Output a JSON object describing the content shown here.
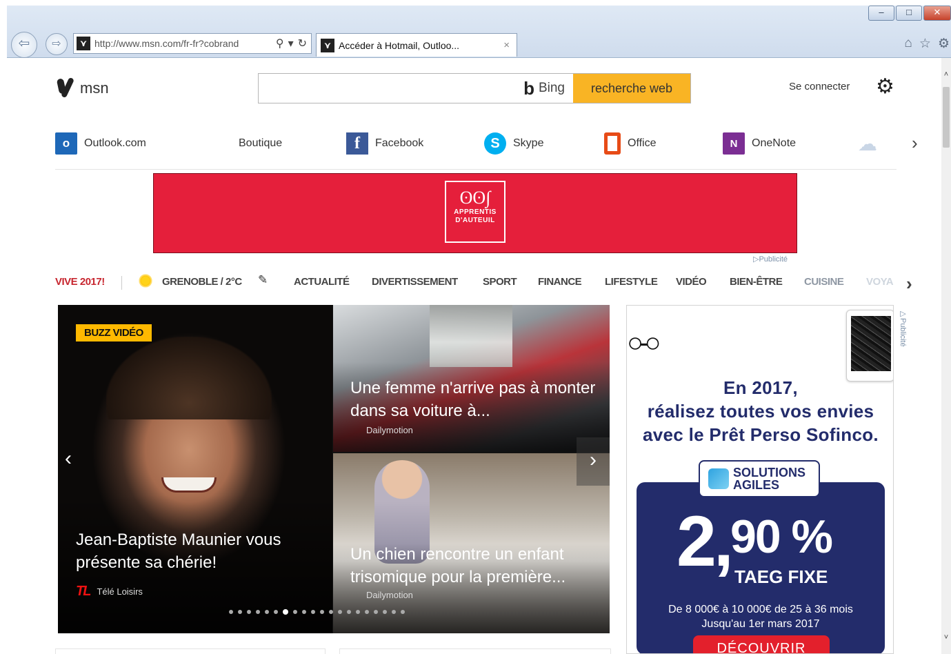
{
  "browser": {
    "url": "http://www.msn.com/fr-fr?cobrand",
    "tab_title": "Accéder à Hotmail, Outloo...",
    "tab_close": "×",
    "back_glyph": "⇦",
    "forward_glyph": "⇨",
    "window_buttons": [
      "–",
      "□",
      "✕"
    ],
    "tool_icons": [
      "home-icon",
      "star-icon",
      "gear-icon"
    ]
  },
  "header": {
    "logo_text": "msn",
    "search_placeholder": "",
    "bing_label": "Bing",
    "search_button": "recherche web",
    "signin": "Se connecter"
  },
  "apps": [
    {
      "label": "Outlook.com",
      "icon": "outlook-icon"
    },
    {
      "label": "Boutique",
      "icon": "store-icon"
    },
    {
      "label": "Facebook",
      "icon": "facebook-icon"
    },
    {
      "label": "Skype",
      "icon": "skype-icon"
    },
    {
      "label": "Office",
      "icon": "office-icon"
    },
    {
      "label": "OneNote",
      "icon": "onenote-icon"
    }
  ],
  "banner": {
    "brand_line1": "APPRENTIS",
    "brand_line2": "D'AUTEUIL",
    "ad_label": "▷Publicité"
  },
  "nav": {
    "highlight": "VIVE 2017!",
    "weather": "GRENOBLE / 2°C",
    "items": [
      "ACTUALITÉ",
      "DIVERTISSEMENT",
      "SPORT",
      "FINANCE",
      "LIFESTYLE",
      "VIDÉO",
      "BIEN-ÊTRE",
      "CUISINE",
      "VOYA"
    ]
  },
  "carousel": {
    "badge": "BUZZ VIDÉO",
    "hero_title": "Jean-Baptiste Maunier vous présente sa chérie!",
    "hero_source": "Télé Loisirs",
    "hero_source_logo": "TL",
    "card1_title": "Une femme n'arrive pas à monter dans sa voiture à...",
    "card1_source": "Dailymotion",
    "card2_title": "Un chien rencontre un enfant trisomique pour la première...",
    "card2_source": "Dailymotion",
    "dot_count": 20,
    "active_dot": 6
  },
  "side_ad": {
    "line1": "En 2017,",
    "line2": "réalisez toutes vos envies",
    "line3": "avec le Prêt Perso Sofinco.",
    "solutions_line1": "SOLUTIONS",
    "solutions_line2": "AGILES",
    "rate_int": "2,",
    "rate_dec": "90 %",
    "taeg": "TAEG FIXE",
    "terms1": "De 8 000€ à 10 000€ de 25 à 36 mois",
    "terms2": "Jusqu'au 1er mars 2017",
    "cta": "DÉCOUVRIR",
    "ad_label": "▷Publicité"
  }
}
